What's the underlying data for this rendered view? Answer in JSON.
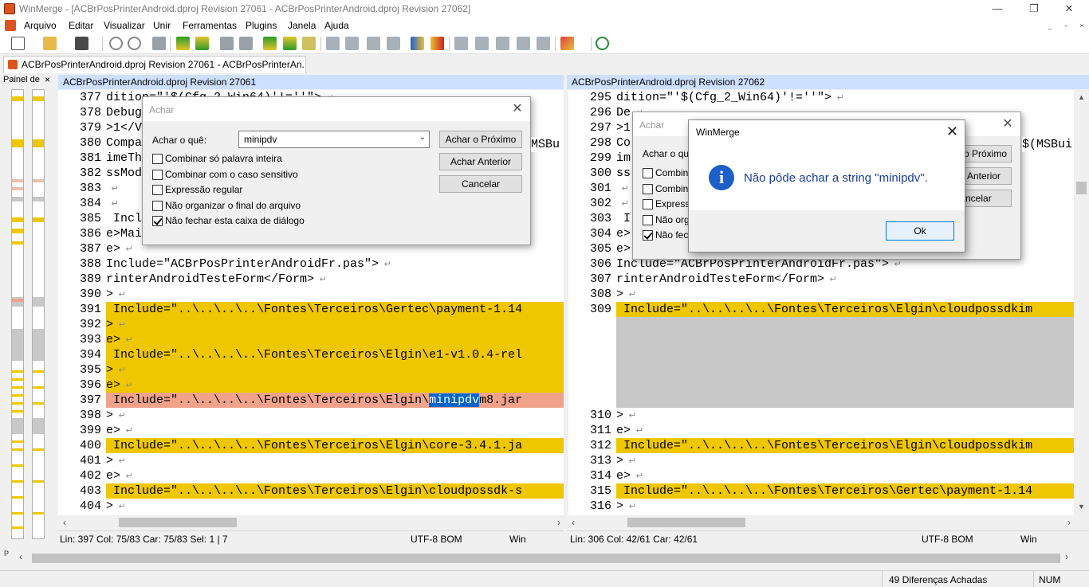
{
  "window": {
    "title": "WinMerge - [ACBrPosPrinterAndroid.dproj Revision 27061 - ACBrPosPrinterAndroid.dproj Revision 27062]",
    "minimize": "—",
    "restore": "❐",
    "close": "✕"
  },
  "menu": [
    "Arquivo",
    "Editar",
    "Visualizar",
    "Unir",
    "Ferramentas",
    "Plugins",
    "Janela",
    "Ajuda"
  ],
  "tab": {
    "label": "ACBrPosPrinterAndroid.dproj Revision 27061 - ACBrPosPrinterAn..."
  },
  "location_pane": {
    "title": "Painel de",
    "close": "×"
  },
  "left": {
    "header": "ACBrPosPrinterAndroid.dproj Revision 27061",
    "lines": [
      {
        "n": "377",
        "t": "dition=\"'$(Cfg_2_Win64)'!=''\">",
        "c": ""
      },
      {
        "n": "378",
        "t": "Debug",
        "c": ""
      },
      {
        "n": "379",
        "t": ">1</V",
        "c": ""
      },
      {
        "n": "380",
        "t": "Compa",
        "c": ""
      },
      {
        "n": "381",
        "t": "imeTh",
        "c": ""
      },
      {
        "n": "382",
        "t": "ssMod",
        "c": ""
      },
      {
        "n": "383",
        "t": "",
        "c": ""
      },
      {
        "n": "384",
        "t": "",
        "c": ""
      },
      {
        "n": "385",
        "t": " Incl",
        "c": ""
      },
      {
        "n": "386",
        "t": "e>Mai",
        "c": ""
      },
      {
        "n": "387",
        "t": "e>",
        "c": ""
      },
      {
        "n": "388",
        "t": "Include=\"ACBrPosPrinterAndroidFr.pas\">",
        "c": ""
      },
      {
        "n": "389",
        "t": "rinterAndroidTesteForm</Form>",
        "c": ""
      },
      {
        "n": "390",
        "t": ">",
        "c": ""
      },
      {
        "n": "391",
        "t": " Include=\"..\\..\\..\\..\\Fontes\\Terceiros\\Gertec\\payment-1.14",
        "c": "y"
      },
      {
        "n": "392",
        "t": ">",
        "c": "y"
      },
      {
        "n": "393",
        "t": "e>",
        "c": "y"
      },
      {
        "n": "394",
        "t": " Include=\"..\\..\\..\\..\\Fontes\\Terceiros\\Elgin\\e1-v1.0.4-rel",
        "c": "y"
      },
      {
        "n": "395",
        "t": ">",
        "c": "y"
      },
      {
        "n": "396",
        "t": "e>",
        "c": "y"
      },
      {
        "n": "397",
        "t": " Include=\"..\\..\\..\\..\\Fontes\\Terceiros\\Elgin\\minipdvm8.jar",
        "c": "or"
      },
      {
        "n": "398",
        "t": ">",
        "c": ""
      },
      {
        "n": "399",
        "t": "e>",
        "c": ""
      },
      {
        "n": "400",
        "t": " Include=\"..\\..\\..\\..\\Fontes\\Terceiros\\Elgin\\core-3.4.1.ja",
        "c": "y"
      },
      {
        "n": "401",
        "t": ">",
        "c": ""
      },
      {
        "n": "402",
        "t": "e>",
        "c": ""
      },
      {
        "n": "403",
        "t": " Include=\"..\\..\\..\\..\\Fontes\\Terceiros\\Elgin\\cloudpossdk-s",
        "c": "y"
      },
      {
        "n": "404",
        "t": ">",
        "c": ""
      }
    ],
    "status": {
      "pos": "Lin: 397  Col: 75/83  Car: 75/83  Sel: 1 | 7",
      "enc": "UTF-8 BOM",
      "eol": "Win"
    }
  },
  "right": {
    "header": "ACBrPosPrinterAndroid.dproj Revision 27062",
    "lines": [
      {
        "n": "295",
        "t": "dition=\"'$(Cfg_2_Win64)'!=''\">",
        "c": ""
      },
      {
        "n": "296",
        "t": "De",
        "c": ""
      },
      {
        "n": "297",
        "t": ">1",
        "c": ""
      },
      {
        "n": "298",
        "t": "Co",
        "c": ""
      },
      {
        "n": "299",
        "t": "im",
        "c": ""
      },
      {
        "n": "300",
        "t": "ss",
        "c": ""
      },
      {
        "n": "301",
        "t": "",
        "c": ""
      },
      {
        "n": "302",
        "t": "",
        "c": ""
      },
      {
        "n": "303",
        "t": " I",
        "c": ""
      },
      {
        "n": "304",
        "t": "e>",
        "c": ""
      },
      {
        "n": "305",
        "t": "e>",
        "c": ""
      },
      {
        "n": "306",
        "t": "Include=\"ACBrPosPrinterAndroidFr.pas\">",
        "c": ""
      },
      {
        "n": "307",
        "t": "rinterAndroidTesteForm</Form>",
        "c": ""
      },
      {
        "n": "308",
        "t": ">",
        "c": ""
      },
      {
        "n": "309",
        "t": " Include=\"..\\..\\..\\..\\Fontes\\Terceiros\\Elgin\\cloudpossdkim",
        "c": "y"
      },
      {
        "n": "",
        "t": "",
        "c": "gray"
      },
      {
        "n": "",
        "t": "",
        "c": "gray"
      },
      {
        "n": "",
        "t": "",
        "c": "gray"
      },
      {
        "n": "",
        "t": "",
        "c": "gray"
      },
      {
        "n": "",
        "t": "",
        "c": "gray"
      },
      {
        "n": "",
        "t": "",
        "c": "gray"
      },
      {
        "n": "310",
        "t": ">",
        "c": ""
      },
      {
        "n": "311",
        "t": "e>",
        "c": ""
      },
      {
        "n": "312",
        "t": " Include=\"..\\..\\..\\..\\Fontes\\Terceiros\\Elgin\\cloudpossdkim",
        "c": "y"
      },
      {
        "n": "313",
        "t": ">",
        "c": ""
      },
      {
        "n": "314",
        "t": "e>",
        "c": ""
      },
      {
        "n": "315",
        "t": " Include=\"..\\..\\..\\..\\Fontes\\Terceiros\\Gertec\\payment-1.14",
        "c": "y"
      },
      {
        "n": "316",
        "t": ">",
        "c": ""
      }
    ],
    "status": {
      "pos": "Lin: 306  Col: 42/61  Car: 42/61",
      "enc": "UTF-8 BOM",
      "eol": "Win"
    }
  },
  "find_dialog": {
    "title": "Achar",
    "find_label": "Achar o quê:",
    "find_value": "minipdv",
    "find_next": "Achar o Próximo",
    "find_prev": "Achar Anterior",
    "cancel": "Cancelar",
    "options": [
      {
        "label": "Combinar só palavra inteira",
        "checked": false
      },
      {
        "label": "Combinar com o caso sensitivo",
        "checked": false
      },
      {
        "label": "Expressão regular",
        "checked": false
      },
      {
        "label": "Não organizar o final do arquivo",
        "checked": false
      },
      {
        "label": "Não fechar esta caixa de diálogo",
        "checked": true
      }
    ]
  },
  "find_dialog2": {
    "title": "Achar",
    "find_label": "Achar o qu",
    "btn1": "o Próximo",
    "btn2": "Anterior",
    "btn3": "ncelar",
    "opts": [
      "Combin",
      "Combin",
      "Express",
      "Não org",
      "Não fech"
    ],
    "right_text": "$(MSBui"
  },
  "msgbox": {
    "title": "WinMerge",
    "text": "Não pôde achar a string \"minipdv\".",
    "ok": "Ok",
    "icon": "i"
  },
  "left_extra": {
    "msbu": "MSBu"
  },
  "statusbar": {
    "diffs": "49 Diferenças Achadas",
    "num": "NUM"
  },
  "bottom_label": "P"
}
